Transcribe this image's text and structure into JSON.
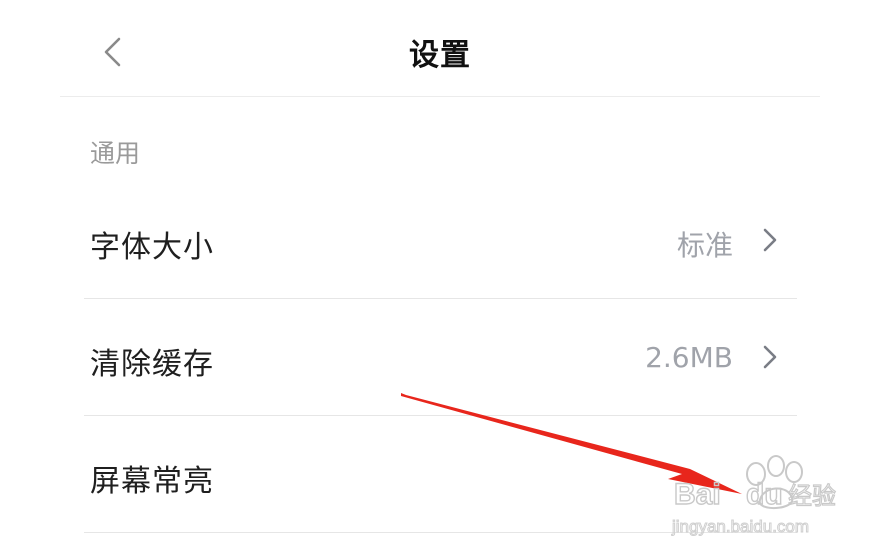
{
  "header": {
    "title": "设置",
    "back_icon": "chevron-left-icon"
  },
  "section": {
    "label": "通用"
  },
  "rows": [
    {
      "label": "字体大小",
      "value": "标准",
      "icon": "chevron-right-icon"
    },
    {
      "label": "清除缓存",
      "value": "2.6MB",
      "icon": "chevron-right-icon"
    },
    {
      "label": "屏幕常亮",
      "value": "",
      "icon": ""
    }
  ],
  "watermark": {
    "brand": "Baidu经验",
    "url": "jingyan.baidu.com"
  },
  "colors": {
    "annotation_arrow": "#e8261c",
    "secondary_text": "#a0a3aa",
    "divider": "#e6e6e6"
  }
}
